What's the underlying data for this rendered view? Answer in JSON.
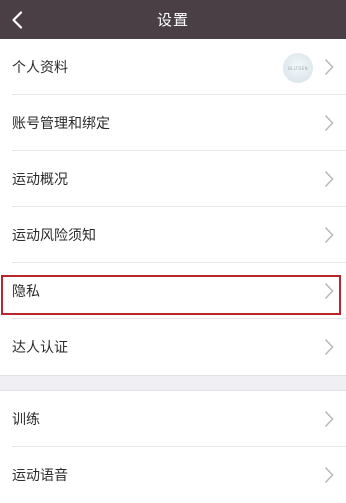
{
  "header": {
    "title": "设置",
    "back_icon": "chevron-left-icon"
  },
  "avatar_text": "BLLTDEN",
  "section1": [
    {
      "label": "个人资料"
    },
    {
      "label": "账号管理和绑定"
    },
    {
      "label": "运动概况"
    },
    {
      "label": "运动风险须知"
    },
    {
      "label": "隐私"
    },
    {
      "label": "达人认证"
    }
  ],
  "section2": [
    {
      "label": "训练"
    },
    {
      "label": "运动语音"
    }
  ],
  "colors": {
    "header_bg": "#4a3f44",
    "highlight_border": "#b8262c",
    "section_gap": "#efeff4"
  }
}
